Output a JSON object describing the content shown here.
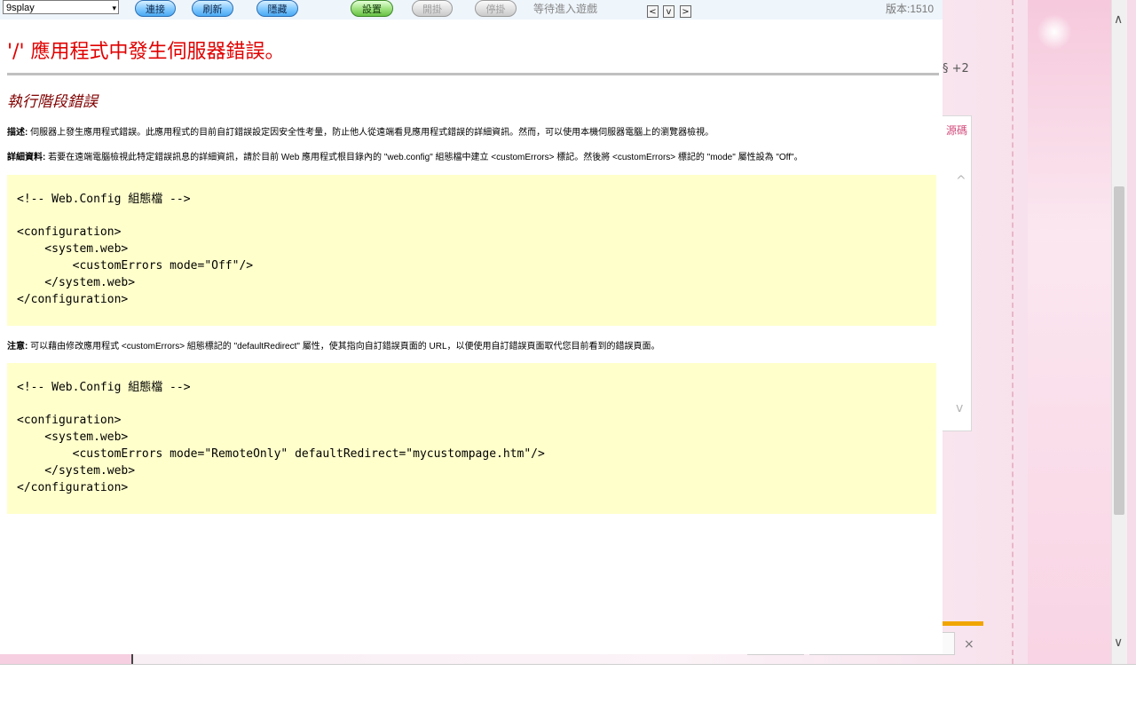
{
  "toolbar": {
    "server_select": "9splay",
    "buttons": {
      "connect": "連接",
      "refresh": "刷新",
      "hide": "隱藏",
      "settings": "設置",
      "start_hang": "開掛",
      "stop_hang": "停掛"
    },
    "status": "等待進入遊戲",
    "nav": {
      "prev": "<",
      "down": "v",
      "next": ">"
    },
    "version": "版本:1510"
  },
  "error_page": {
    "title": "'/' 應用程式中發生伺服器錯誤。",
    "subtitle": "執行階段錯誤",
    "description_label": "描述:",
    "description_text": " 伺服器上發生應用程式錯誤。此應用程式的目前自訂錯誤設定因安全性考量，防止他人從遠端看見應用程式錯誤的詳細資訊。然而，可以使用本機伺服器電腦上的瀏覽器檢視。",
    "details_label": "詳細資料:",
    "details_text": " 若要在遠端電腦檢視此特定錯誤訊息的詳細資訊，請於目前 Web 應用程式根目錄內的 \"web.config\" 組態檔中建立 <customErrors> 標記。然後將 <customErrors> 標記的 \"mode\" 屬性設為 \"Off\"。",
    "code1": [
      "",
      "<!-- Web.Config 組態檔 -->",
      "",
      "<configuration>",
      "    <system.web>",
      "        <customErrors mode=\"Off\"/>",
      "    </system.web>",
      "</configuration>"
    ],
    "note_label": "注意:",
    "note_text": " 可以藉由修改應用程式 <customErrors> 組態標記的 \"defaultRedirect\" 屬性，使其指向自訂錯誤頁面的 URL，以便使用自訂錯誤頁面取代您目前看到的錯誤頁面。",
    "code2": [
      "",
      "<!-- Web.Config 組態檔 -->",
      "",
      "<configuration>",
      "    <system.web>",
      "        <customErrors mode=\"RemoteOnly\" defaultRedirect=\"mycustompage.htm\"/>",
      "    </system.web>",
      "</configuration>"
    ]
  },
  "background": {
    "count_text": "§ +2",
    "panel_label": "源碼",
    "close_glyph": "×"
  },
  "icons": {
    "select_arrow": "▾",
    "chevron_up": "^",
    "chevron_down": "v",
    "scroll_up": "∧",
    "scroll_down": "∨"
  },
  "colors": {
    "title_red": "#e00000",
    "subtitle_maroon": "#800000",
    "code_bg": "#ffffcc",
    "pill_blue": "#7fc8ff",
    "pill_green": "#9be07c"
  }
}
